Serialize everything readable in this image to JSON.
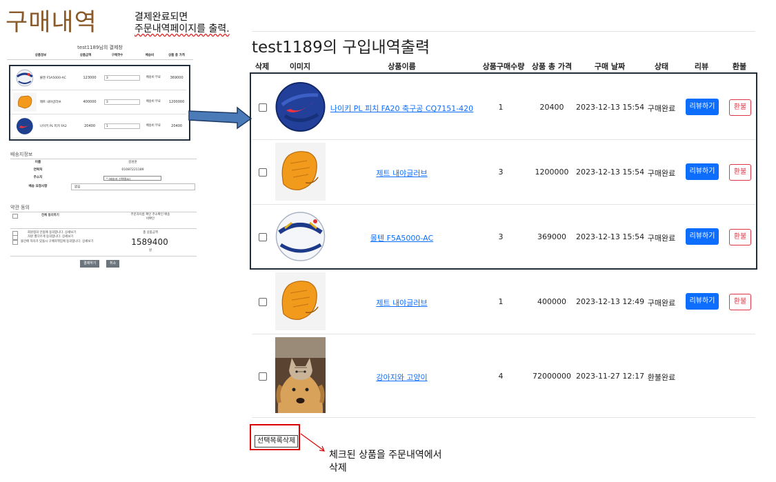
{
  "slide": {
    "title": "구매내역",
    "note_top_1": "결제완료되면",
    "note_top_2": "주문내역페이지를 출력.",
    "note_bottom_1": "체크된 상품을 주문내역에서",
    "note_bottom_2": "삭제"
  },
  "checkout_preview": {
    "caption": "test1189님의 결제창",
    "headers": [
      "상품정보",
      "상품금액",
      "구매갯수",
      "배송비",
      "상품 총 가격"
    ],
    "items": [
      {
        "name": "몰텐 F5A5000-AC",
        "price": "123000",
        "qty": "3",
        "shipping": "배송비 무료",
        "total": "369000"
      },
      {
        "name": "제트 내야글러브",
        "price": "400000",
        "qty": "3",
        "shipping": "배송비 무료",
        "total": "1200000"
      },
      {
        "name": "나이키 PL 피치 FA2",
        "price": "20400",
        "qty": "1",
        "shipping": "배송비 무료",
        "total": "20400"
      }
    ],
    "shipping_title": "배송지정보",
    "fields": [
      {
        "label": "이름",
        "value": "김성훈"
      },
      {
        "label": "연락처",
        "value": "01087221189"
      },
      {
        "label": "주소지",
        "value": "* (배송지 선택필요)"
      },
      {
        "label": "배송 요청사항",
        "value": "없음"
      }
    ],
    "terms_title": "약관 동의",
    "agree_all": "전체 동의하기",
    "order_confirm": "주문자이름 확인 주소확인 배송비확인",
    "terms": [
      "회원정의 안됨에 동의합니다. 상세보기",
      "자원 별다르게 동의합니다. 상세보기",
      "물건에 하자가 있을시 구매자책임에 동의합니다. 상세보기"
    ],
    "total_label": "총 상품금액",
    "total_value": "1589400",
    "total_unit": "원",
    "pay_button": "결제하기",
    "cancel_button": "취소"
  },
  "orders": {
    "title": "test1189의 구입내역출력",
    "headers": [
      "삭제",
      "이미지",
      "상품이름",
      "상품구매수량",
      "상품 총 가격",
      "구매 날짜",
      "상태",
      "리뷰",
      "환불"
    ],
    "rows": [
      {
        "name": "나이키 PL 피치 FA20 축구공 CQ7151-420",
        "qty": "1",
        "total": "20400",
        "date": "2023-12-13 15:54",
        "status": "구매완료",
        "image": "nike-soccer-ball",
        "review": "리뷰하기",
        "refund": "환불"
      },
      {
        "name": "제트 내야글러브",
        "qty": "3",
        "total": "1200000",
        "date": "2023-12-13 15:54",
        "status": "구매완료",
        "image": "baseball-glove",
        "review": "리뷰하기",
        "refund": "환불"
      },
      {
        "name": "몰텐 F5A5000-AC",
        "qty": "3",
        "total": "369000",
        "date": "2023-12-13 15:54",
        "status": "구매완료",
        "image": "molten-soccer-ball",
        "review": "리뷰하기",
        "refund": "환불"
      },
      {
        "name": "제트 내야글러브",
        "qty": "1",
        "total": "400000",
        "date": "2023-12-13 12:49",
        "status": "구매완료",
        "image": "baseball-glove",
        "review": "리뷰하기",
        "refund": "환불"
      },
      {
        "name": "강아지와 고양이",
        "qty": "4",
        "total": "72000000",
        "date": "2023-11-27 12:17",
        "status": "환불완료",
        "image": "dog-and-cat-photo"
      }
    ],
    "bulk_delete": "선택목록삭제"
  }
}
